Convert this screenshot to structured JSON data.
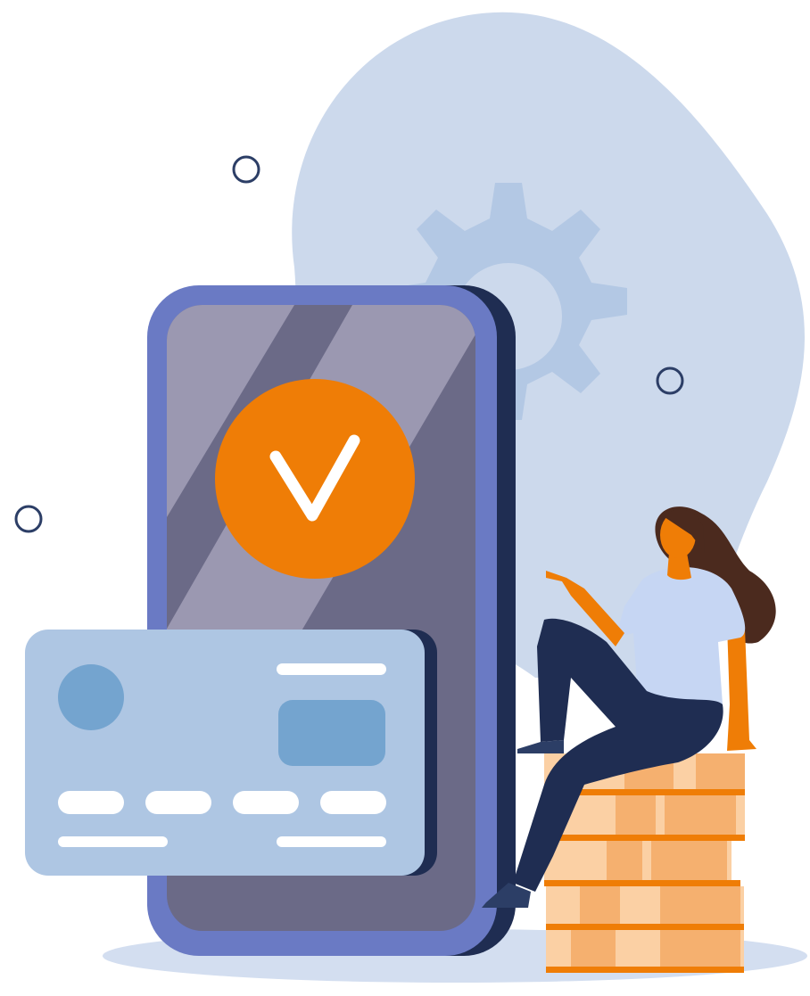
{
  "illustration": {
    "subject": "payment-confirmed",
    "colors": {
      "blob": "#ccd9ec",
      "gear": "#b3c8e4",
      "shadow": "#d3def0",
      "phone_frame": "#6a7ac4",
      "phone_back": "#1f2d52",
      "phone_screen": "#6b6a87",
      "phone_stripe": "#9b98b1",
      "badge": "#ef7d06",
      "card_body": "#aec6e3",
      "card_back": "#1f2d52",
      "card_chip": "#74a4cf",
      "coin_light": "#fbd0a4",
      "coin_mid": "#f5b06f",
      "coin_band": "#ef7d06",
      "skin": "#ef7d06",
      "hair": "#4b2a1e",
      "shirt": "#c6d6f3",
      "pants": "#1f2d52",
      "outline_circle": "#2c3e66"
    },
    "icons": [
      "check-icon",
      "gear-icon",
      "card-chip-icon",
      "coins-stack"
    ]
  }
}
